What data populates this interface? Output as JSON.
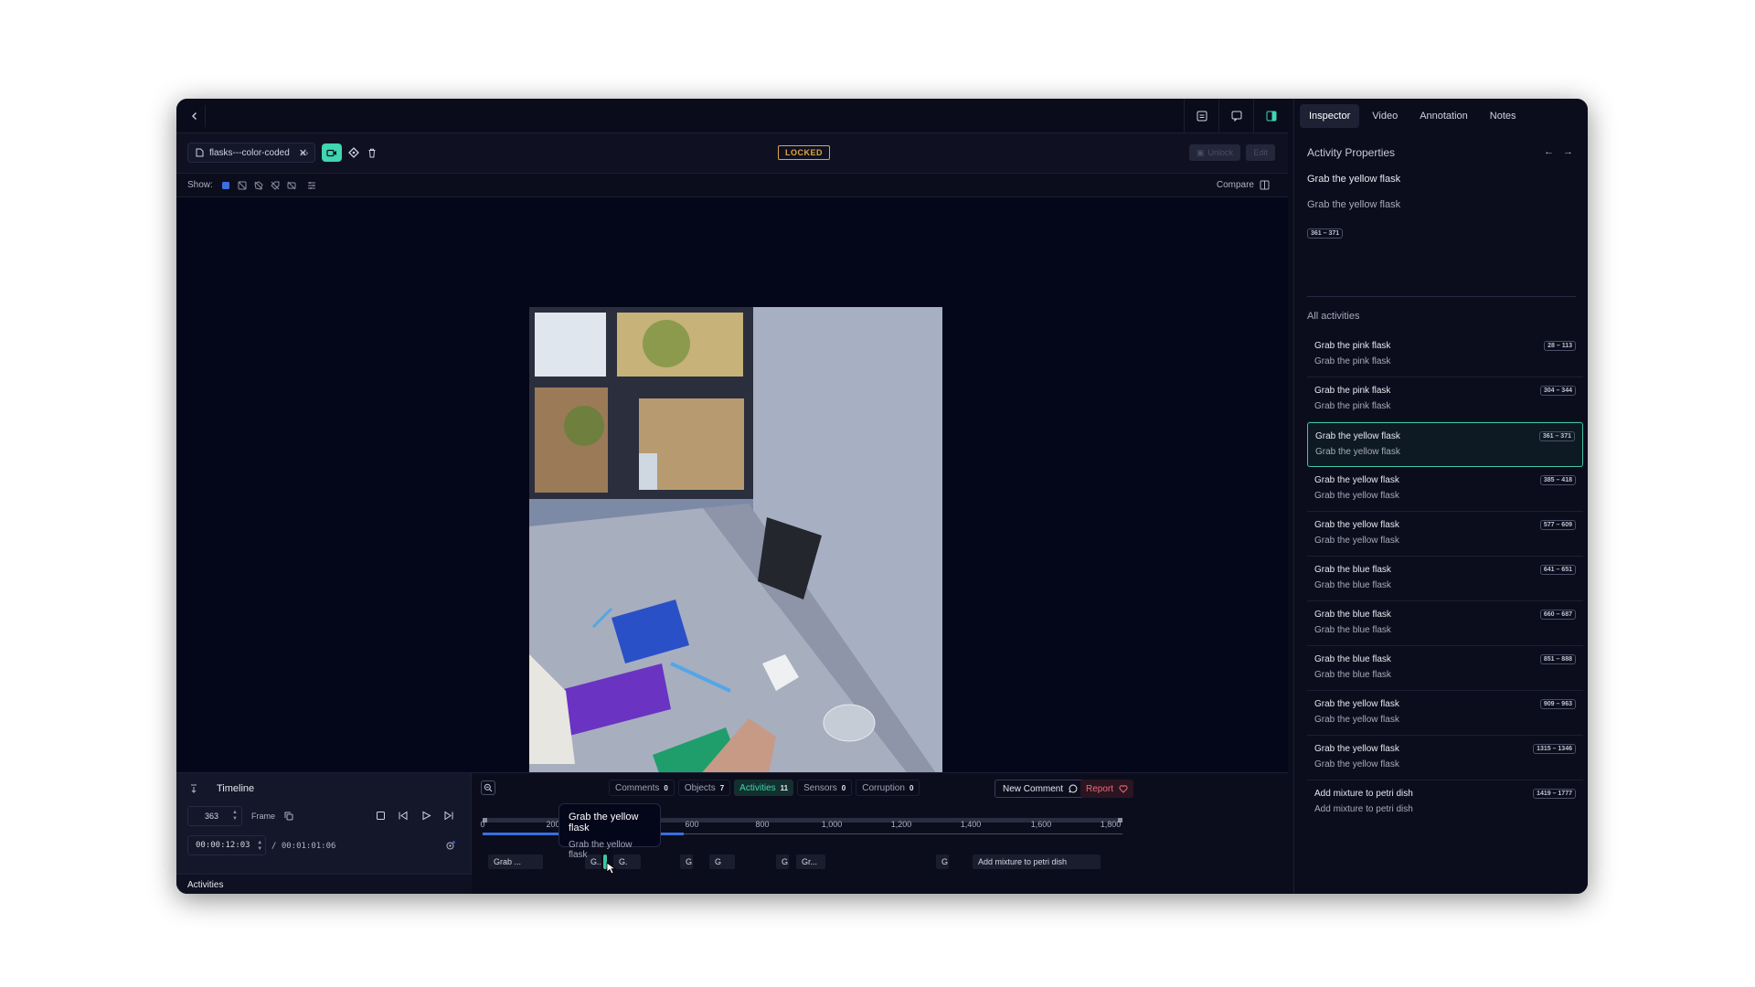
{
  "colors": {
    "accent": "#3fd6b0",
    "locked": "#e0a640",
    "report": "#e05060",
    "bg": "#0b0d1d"
  },
  "file": {
    "name": "flasks---color-coded"
  },
  "toolbar": {
    "locked_label": "LOCKED",
    "unlock_label": "Unlock",
    "edit_label": "Edit"
  },
  "showbar": {
    "show_label": "Show:",
    "compare_label": "Compare"
  },
  "timeline": {
    "title": "Timeline",
    "frame_value": "363",
    "frame_label": "Frame",
    "time_value": "00:00:12:03",
    "duration": "/ 00:01:01:06",
    "activities_label": "Activities",
    "filters": [
      {
        "label": "Comments",
        "count": "0"
      },
      {
        "label": "Objects",
        "count": "7"
      },
      {
        "label": "Activities",
        "count": "11"
      },
      {
        "label": "Sensors",
        "count": "0"
      },
      {
        "label": "Corruption",
        "count": "0"
      }
    ],
    "new_comment_label": "New Comment",
    "report_label": "Report",
    "ruler": [
      "0",
      "200",
      "400",
      "600",
      "800",
      "1,000",
      "1,200",
      "1,400",
      "1,600",
      "1,800"
    ],
    "segments": [
      "Grab ...",
      "G..",
      "G.",
      "G.",
      "G",
      "G.",
      "Gr...",
      "G",
      "Add mixture to petri dish"
    ],
    "tooltip": {
      "title": "Grab the yellow flask",
      "subtitle": "Grab the yellow flask"
    }
  },
  "inspector": {
    "tabs": [
      "Inspector",
      "Video",
      "Annotation",
      "Notes"
    ],
    "panel_title": "Activity Properties",
    "selected_title": "Grab the yellow flask",
    "selected_subtitle": "Grab the yellow flask",
    "selected_range": "361 – 371",
    "all_label": "All activities",
    "activities": [
      {
        "title": "Grab the pink flask",
        "subtitle": "Grab the pink flask",
        "range": "28 – 113"
      },
      {
        "title": "Grab the pink flask",
        "subtitle": "Grab the pink flask",
        "range": "304 – 344"
      },
      {
        "title": "Grab the yellow flask",
        "subtitle": "Grab the yellow flask",
        "range": "361 – 371"
      },
      {
        "title": "Grab the yellow flask",
        "subtitle": "Grab the yellow flask",
        "range": "385 – 418"
      },
      {
        "title": "Grab the yellow flask",
        "subtitle": "Grab the yellow flask",
        "range": "577 – 609"
      },
      {
        "title": "Grab the blue flask",
        "subtitle": "Grab the blue flask",
        "range": "641 – 651"
      },
      {
        "title": "Grab the blue flask",
        "subtitle": "Grab the blue flask",
        "range": "660 – 687"
      },
      {
        "title": "Grab the blue flask",
        "subtitle": "Grab the blue flask",
        "range": "851 – 888"
      },
      {
        "title": "Grab the yellow flask",
        "subtitle": "Grab the yellow flask",
        "range": "909 – 963"
      },
      {
        "title": "Grab the yellow flask",
        "subtitle": "Grab the yellow flask",
        "range": "1315 – 1346"
      },
      {
        "title": "Add mixture to petri dish",
        "subtitle": "Add mixture to petri dish",
        "range": "1419 – 1777"
      }
    ]
  }
}
